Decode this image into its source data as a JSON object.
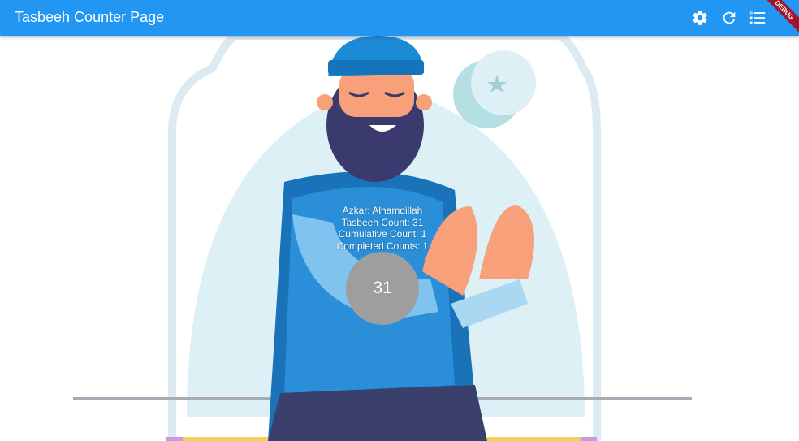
{
  "appbar": {
    "title": "Tasbeeh Counter Page",
    "background": "#2196f3",
    "actions": [
      {
        "icon": "gear-icon"
      },
      {
        "icon": "refresh-icon"
      },
      {
        "icon": "list-icon"
      }
    ]
  },
  "debug_banner": "DEBUG",
  "info": {
    "azkar": "Azkar: Alhamdillah",
    "tasbeeh_count": "Tasbeeh Count: 31",
    "cumulative_count": "Cumulative Count: 1",
    "completed_counts": "Completed Counts: 1"
  },
  "counter": {
    "value": "31",
    "color": "#9e9e9e"
  }
}
